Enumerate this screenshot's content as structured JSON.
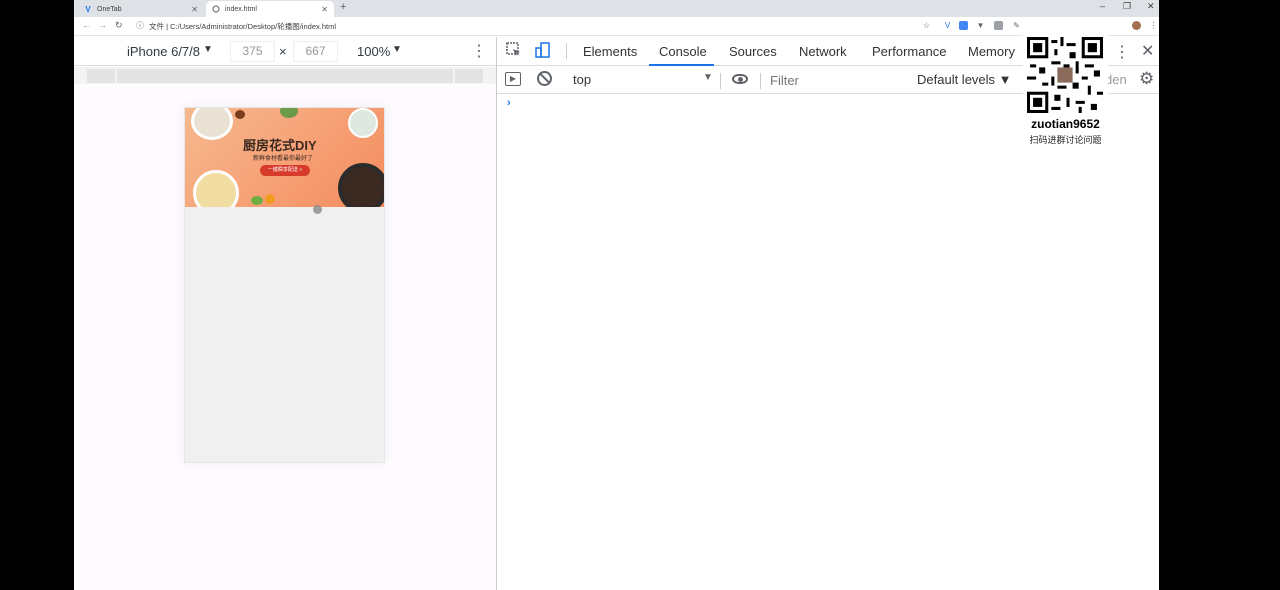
{
  "browser": {
    "tabs": [
      {
        "label": "OneTab",
        "icon": "onetab-icon"
      },
      {
        "label": "index.html",
        "icon": "page-icon"
      }
    ],
    "new_tab": "+",
    "window_controls": {
      "minimize": "–",
      "restore": "❐",
      "close": "✕"
    },
    "address": {
      "info": "ⓘ",
      "text": "文件 | C:/Users/Administrator/Desktop/轮播图/index.html"
    }
  },
  "device_toolbar": {
    "device": "iPhone 6/7/8",
    "width": "375",
    "height": "667",
    "times": "×",
    "zoom": "100%"
  },
  "page": {
    "banner_title": "厨房花式DIY",
    "banner_subtitle": "新鲜食材看最你最好了",
    "banner_button": "一键瞬享配送 »"
  },
  "devtools": {
    "tabs": [
      "Elements",
      "Console",
      "Sources",
      "Network",
      "Performance",
      "Memory"
    ],
    "active_tab": "Console",
    "context": "top",
    "filter_placeholder": "Filter",
    "levels": "Default levels ▼",
    "hidden_fragment": "den",
    "prompt": "›"
  },
  "overlay": {
    "id": "zuotian9652",
    "caption": "扫码进群讨论问题"
  },
  "colors": {
    "accent": "#1a73e8",
    "banner": "#f7a277",
    "banner_button": "#d63b2c"
  }
}
